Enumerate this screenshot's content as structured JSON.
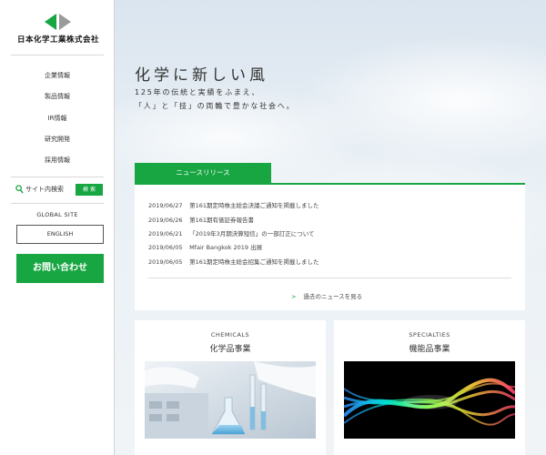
{
  "brand": {
    "name": "日本化学工業株式会社"
  },
  "nav": {
    "items": [
      "企業情報",
      "製品情報",
      "IR情報",
      "研究開発",
      "採用情報"
    ]
  },
  "search": {
    "label": "サイト内検索",
    "button": "検 索"
  },
  "global": {
    "label": "GLOBAL SITE",
    "english": "ENGLISH"
  },
  "contact": {
    "label": "お問い合わせ"
  },
  "hero": {
    "headline": "化学に新しい風",
    "sub1": "125年の伝統と実績をふまえ、",
    "sub2": "「人」と「技」の両輪で豊かな社会へ。"
  },
  "news": {
    "tab": "ニュースリリース",
    "items": [
      {
        "date": "2019/06/27",
        "title": "第161期定時株主総会決議ご通知を掲載しました"
      },
      {
        "date": "2019/06/26",
        "title": "第161期有価証券報告書"
      },
      {
        "date": "2019/06/21",
        "title": "「2019年3月期決算短信」の一部訂正について"
      },
      {
        "date": "2019/06/05",
        "title": "Mfair Bangkok 2019 出展"
      },
      {
        "date": "2019/06/05",
        "title": "第161期定時株主総会招集ご通知を掲載しました"
      }
    ],
    "more": "過去のニュースを見る"
  },
  "cards": [
    {
      "en": "CHEMICALS",
      "jp": "化学品事業"
    },
    {
      "en": "SPECIALTIES",
      "jp": "機能品事業"
    }
  ],
  "colors": {
    "accent": "#18a642"
  }
}
